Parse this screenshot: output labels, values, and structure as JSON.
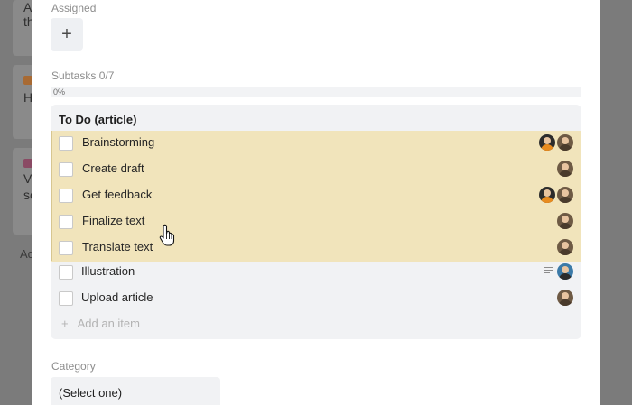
{
  "board_background": {
    "cards": [
      {
        "text_fragments": [
          "A",
          "th"
        ]
      },
      {
        "tag_color": "#d9822b",
        "text_fragments": [
          "H"
        ]
      },
      {
        "tag_color": "#a5446c",
        "text_fragments": [
          "V",
          "sc"
        ]
      }
    ],
    "add_card_fragment": "Ad"
  },
  "modal": {
    "assigned_label": "Assigned",
    "add_assignee_symbol": "+",
    "subtasks_label": "Subtasks 0/7",
    "progress": {
      "percent_text": "0%",
      "value": 0
    },
    "checklist": {
      "title": "To Do (article)",
      "items": [
        {
          "label": "Brainstorming",
          "selected": true,
          "avatars": [
            "a",
            "b"
          ]
        },
        {
          "label": "Create draft",
          "selected": true,
          "avatars": [
            "b"
          ]
        },
        {
          "label": "Get feedback",
          "selected": true,
          "avatars": [
            "a",
            "b"
          ]
        },
        {
          "label": "Finalize text",
          "selected": true,
          "avatars": [
            "b"
          ]
        },
        {
          "label": "Translate text",
          "selected": true,
          "avatars": [
            "b"
          ]
        },
        {
          "label": "Illustration",
          "selected": false,
          "has_description": true,
          "avatars": [
            "c"
          ]
        },
        {
          "label": "Upload article",
          "selected": false,
          "avatars": [
            "b"
          ]
        }
      ],
      "add_item_symbol": "+",
      "add_item_label": "Add an item"
    },
    "category_label": "Category",
    "category_value": "(Select one)"
  }
}
